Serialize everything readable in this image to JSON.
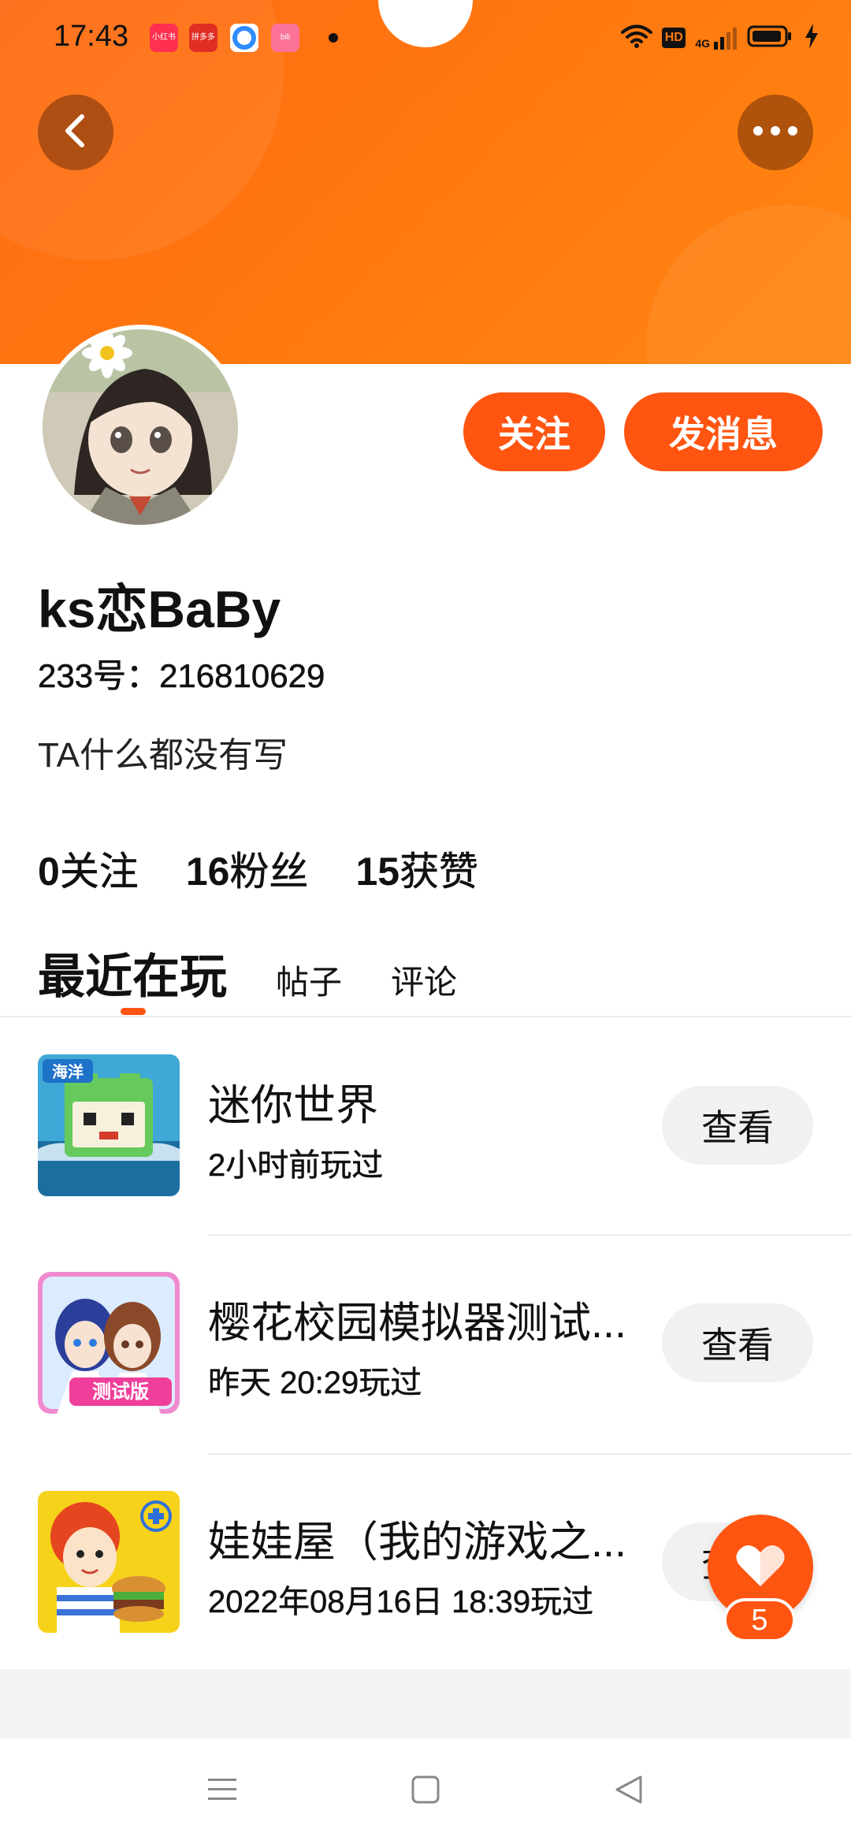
{
  "status_bar": {
    "time": "17:43",
    "apps": [
      {
        "icon": "xiaohongshu-icon",
        "label": "小红书",
        "color": "#ff2f4f"
      },
      {
        "icon": "pinduoduo-icon",
        "label": "拼多多",
        "color": "#e02e24"
      },
      {
        "icon": "browser-icon",
        "label": "",
        "color": "#2f8cff"
      },
      {
        "icon": "bilibili-icon",
        "label": "bili",
        "color": "#fb7299"
      }
    ],
    "hd_label": "HD",
    "network": "4G"
  },
  "profile": {
    "username": "ks恋BaBy",
    "user_id": "233号：216810629",
    "bio": "TA什么都没有写",
    "follow_label": "关注",
    "message_label": "发消息"
  },
  "stats": [
    {
      "num": "0",
      "label": "关注"
    },
    {
      "num": "16",
      "label": "粉丝"
    },
    {
      "num": "15",
      "label": "获赞"
    }
  ],
  "tabs": {
    "active": "最近在玩",
    "posts": "帖子",
    "comments": "评论"
  },
  "games": [
    {
      "name": "迷你世界",
      "time": "2小时前玩过",
      "button": "查看"
    },
    {
      "name": "樱花校园模拟器测试...",
      "time": "昨天 20:29玩过",
      "button": "查看"
    },
    {
      "name": "娃娃屋（我的游戏之...",
      "time": "2022年08月16日 18:39玩过",
      "button": "查看"
    }
  ],
  "more_section_title": "",
  "like": {
    "count": "5"
  },
  "colors": {
    "accent": "#ff5511",
    "header_orange": "#ff7a10"
  }
}
